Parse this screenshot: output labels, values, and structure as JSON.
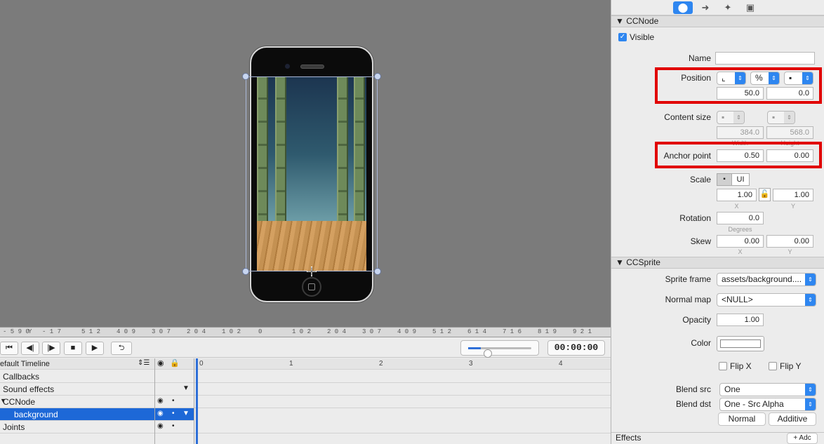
{
  "stage": {
    "selection_handle": "move-cross-icon"
  },
  "ruler": {
    "labels": [
      "- 5 9 0",
      "Y",
      "- 1 7",
      "5 1 2",
      "4 0 9",
      "3 0 7",
      "2 0 4",
      "1 0 2",
      "0",
      "1 0 2",
      "2 0 4",
      "3 0 7",
      "4 0 9",
      "5 1 2",
      "6 1 4",
      "7 1 6",
      "8 1 9",
      "9 2 1"
    ]
  },
  "transport": {
    "first": "⏮",
    "prev": "◀|",
    "next": "|▶",
    "stop": "■",
    "play": "▶",
    "loop": "⮌",
    "timecode": "00:00:00",
    "zoom_percent": 20
  },
  "timeline": {
    "name": "efault Timeline",
    "marks": [
      "0",
      "1",
      "2",
      "3",
      "4"
    ],
    "rows": [
      {
        "label": "Callbacks"
      },
      {
        "label": "Sound effects"
      },
      {
        "label": "CCNode"
      },
      {
        "label": "background"
      },
      {
        "label": "Joints"
      }
    ]
  },
  "inspector": {
    "tabs": [
      "node-properties-icon",
      "code-connections-icon",
      "physics-icon",
      "templates-icon"
    ],
    "ccnode": {
      "title": "CCNode",
      "visible_label": "Visible",
      "name_label": "Name",
      "name_value": "",
      "position_label": "Position",
      "position_unit": "%",
      "position_x": "50.0",
      "position_y": "0.0",
      "content_size_label": "Content size",
      "content_width": "384.0",
      "content_height": "568.0",
      "width_label": "Width",
      "height_label": "Height",
      "anchor_label": "Anchor point",
      "anchor_x": "0.50",
      "anchor_y": "0.00",
      "scale_label": "Scale",
      "scale_ui": "UI",
      "scale_x": "1.00",
      "scale_y": "1.00",
      "x_label": "X",
      "y_label": "Y",
      "rotation_label": "Rotation",
      "rotation_value": "0.0",
      "degrees_label": "Degrees",
      "skew_label": "Skew",
      "skew_x": "0.00",
      "skew_y": "0.00"
    },
    "ccsprite": {
      "title": "CCSprite",
      "sprite_frame_label": "Sprite frame",
      "sprite_frame_value": "assets/background....",
      "normal_map_label": "Normal map",
      "normal_map_value": "<NULL>",
      "opacity_label": "Opacity",
      "opacity_value": "1.00",
      "color_label": "Color",
      "color_value": "#ffffff",
      "flipx_label": "Flip X",
      "flipy_label": "Flip Y",
      "blend_src_label": "Blend src",
      "blend_src_value": "One",
      "blend_dst_label": "Blend dst",
      "blend_dst_value": "One - Src Alpha",
      "normal_btn": "Normal",
      "additive_btn": "Additive"
    },
    "effects": {
      "title": "Effects",
      "add_label": "+ Adc"
    }
  },
  "colors": {
    "accent": "#2e86f0",
    "highlight": "#e10000",
    "selection": "#1d68d7"
  }
}
